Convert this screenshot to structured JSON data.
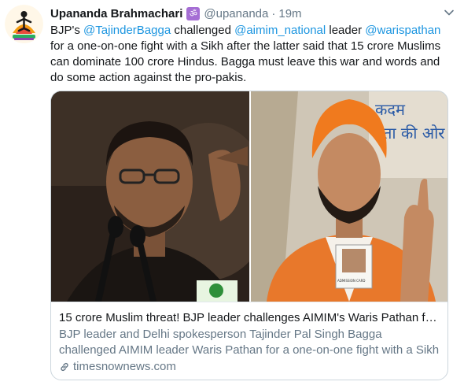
{
  "tweet": {
    "author": {
      "display_name": "Upananda Brahmachari",
      "badge": "ॐ",
      "handle": "@upananda",
      "separator": "·",
      "time": "19m"
    },
    "text": {
      "p1": "BJP's ",
      "m1": "@TajinderBagga",
      "p2": " challenged ",
      "m2": "@aimim_national",
      "p3": " leader ",
      "m3": "@warispathan",
      "p4": " for a one-on-one fight with a Sikh after the latter said that 15 crore Muslims can dominate 100 crore Hindus. Bagga must leave this war and words and do some action against the pro-pakis."
    },
    "card": {
      "title": "15 crore Muslim threat! BJP leader challenges AIMIM's Waris Pathan for ...",
      "description": "BJP leader and Delhi spokesperson Tajinder Pal Singh Bagga challenged AIMIM leader Waris Pathan for a one-on-one fight with a Sikh at the ...",
      "domain": "timesnownews.com",
      "image_right_text": {
        "line1": "कदम",
        "line2": "ता की ओर",
        "badge": "ADMISSION CARD"
      }
    },
    "icons": {
      "caret": "chevron-down-icon",
      "link": "link-icon"
    },
    "colors": {
      "mention": "#1b95e0",
      "secondary_text": "#657786",
      "badge": "#a56ed4"
    }
  }
}
